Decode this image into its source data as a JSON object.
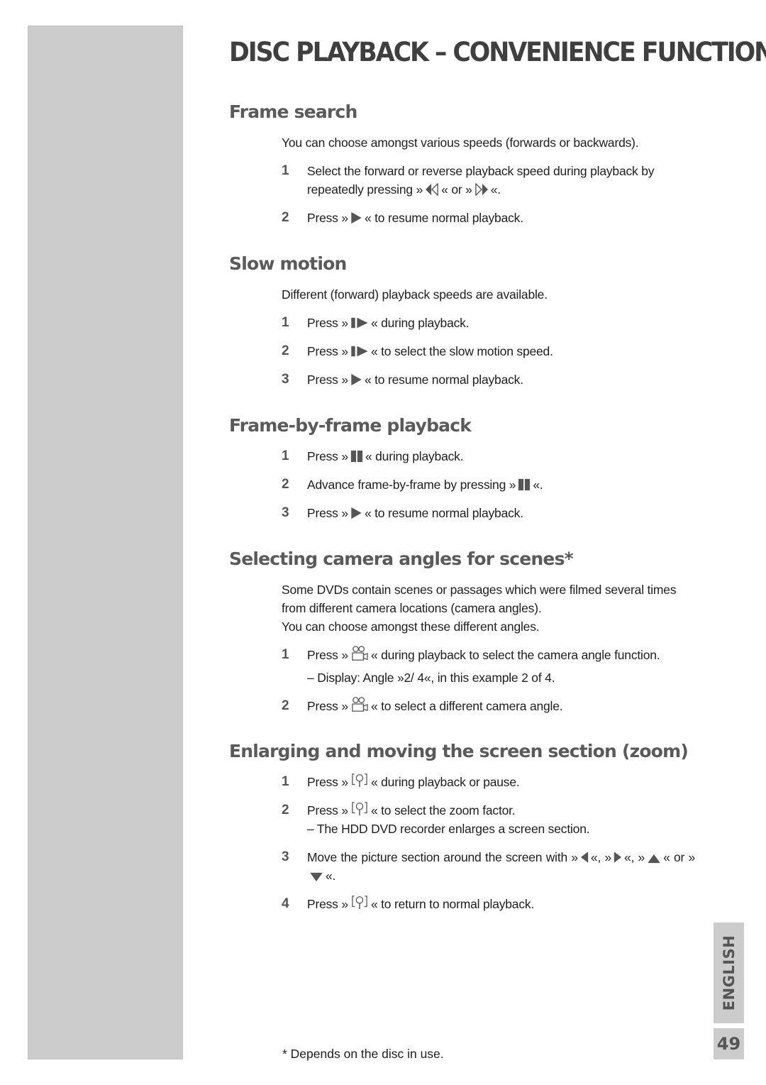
{
  "page": {
    "title": "DISC PLAYBACK – CONVENIENCE FUNCTIONS",
    "language_tab": "ENGLISH",
    "page_number": "49",
    "footnote": "* Depends on the disc in use."
  },
  "icons": {
    "rewind": "rewind-icon",
    "fast_forward": "fast-forward-icon",
    "play": "play-icon",
    "slow_motion": "slow-motion-icon",
    "pause": "pause-icon",
    "camera_angle": "camera-angle-icon",
    "zoom": "zoom-icon",
    "left": "arrow-left-icon",
    "right": "arrow-right-icon",
    "up": "arrow-up-icon",
    "down": "arrow-down-icon"
  },
  "sections": {
    "frame_search": {
      "heading": "Frame search",
      "intro": "You can choose amongst various speeds (forwards or backwards).",
      "steps": [
        {
          "num": "1",
          "a": "Select the forward or reverse playback speed during playback by repeatedly pressing »",
          "b": "« or »",
          "c": "«."
        },
        {
          "num": "2",
          "a": "Press »",
          "b": "« to resume normal playback."
        }
      ]
    },
    "slow_motion": {
      "heading": "Slow motion",
      "intro": "Different (forward) playback speeds are available.",
      "steps": [
        {
          "num": "1",
          "a": "Press »",
          "b": "« during playback."
        },
        {
          "num": "2",
          "a": "Press »",
          "b": "« to select the slow motion speed."
        },
        {
          "num": "3",
          "a": "Press »",
          "b": "« to resume normal playback."
        }
      ]
    },
    "frame_by_frame": {
      "heading": "Frame-by-frame playback",
      "steps": [
        {
          "num": "1",
          "a": "Press »",
          "b": "« during playback."
        },
        {
          "num": "2",
          "a": "Advance frame-by-frame by pressing »",
          "b": "«."
        },
        {
          "num": "3",
          "a": "Press »",
          "b": "« to resume normal playback."
        }
      ]
    },
    "camera_angles": {
      "heading": "Selecting camera angles for scenes*",
      "intro": "Some DVDs contain scenes or passages which were filmed several times from different camera locations (camera angles).",
      "intro2": "You can choose amongst these different angles.",
      "steps": [
        {
          "num": "1",
          "a": "Press »",
          "b": "« during playback to select the camera angle function.",
          "sub": "– Display: Angle »2/ 4«, in this example 2 of 4."
        },
        {
          "num": "2",
          "a": "Press »",
          "b": "« to select a different camera angle."
        }
      ]
    },
    "zoom": {
      "heading": "Enlarging and moving the screen section (zoom)",
      "steps": [
        {
          "num": "1",
          "a": "Press »",
          "b": "« during playback or pause."
        },
        {
          "num": "2",
          "a": "Press »",
          "b": "« to select the zoom factor.",
          "sub": "– The HDD DVD recorder enlarges a screen section."
        },
        {
          "num": "3",
          "a": "Move the picture section around the screen with »",
          "b": "«, »",
          "c": "«, »",
          "d": "« or »",
          "e": "«."
        },
        {
          "num": "4",
          "a": "Press »",
          "b": "« to return to normal playback."
        }
      ]
    }
  }
}
